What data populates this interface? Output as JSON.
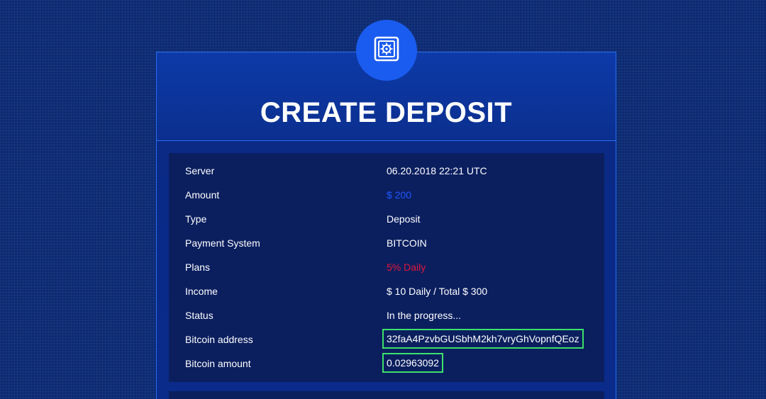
{
  "header": {
    "title": "CREATE DEPOSIT",
    "badge_icon": "safe-icon"
  },
  "colors": {
    "amount": "#1f57ff",
    "plans": "#e0173a",
    "highlight_border": "#3ce06a"
  },
  "details": {
    "server": {
      "label": "Server",
      "value": "06.20.2018 22:21 UTC"
    },
    "amount": {
      "label": "Amount",
      "value": "$ 200"
    },
    "type": {
      "label": "Type",
      "value": "Deposit"
    },
    "payment_system": {
      "label": "Payment System",
      "value": "BITCOIN"
    },
    "plans": {
      "label": "Plans",
      "value": "5% Daily"
    },
    "income": {
      "label": "Income",
      "value": "$ 10 Daily / Total $ 300"
    },
    "status": {
      "label": "Status",
      "value": "In the progress..."
    },
    "bitcoin_address": {
      "label": "Bitcoin address",
      "value": "32faA4PzvbGUSbhM2kh7vryGhVopnfQEoz"
    },
    "bitcoin_amount": {
      "label": "Bitcoin amount",
      "value": "0.02963092"
    }
  }
}
